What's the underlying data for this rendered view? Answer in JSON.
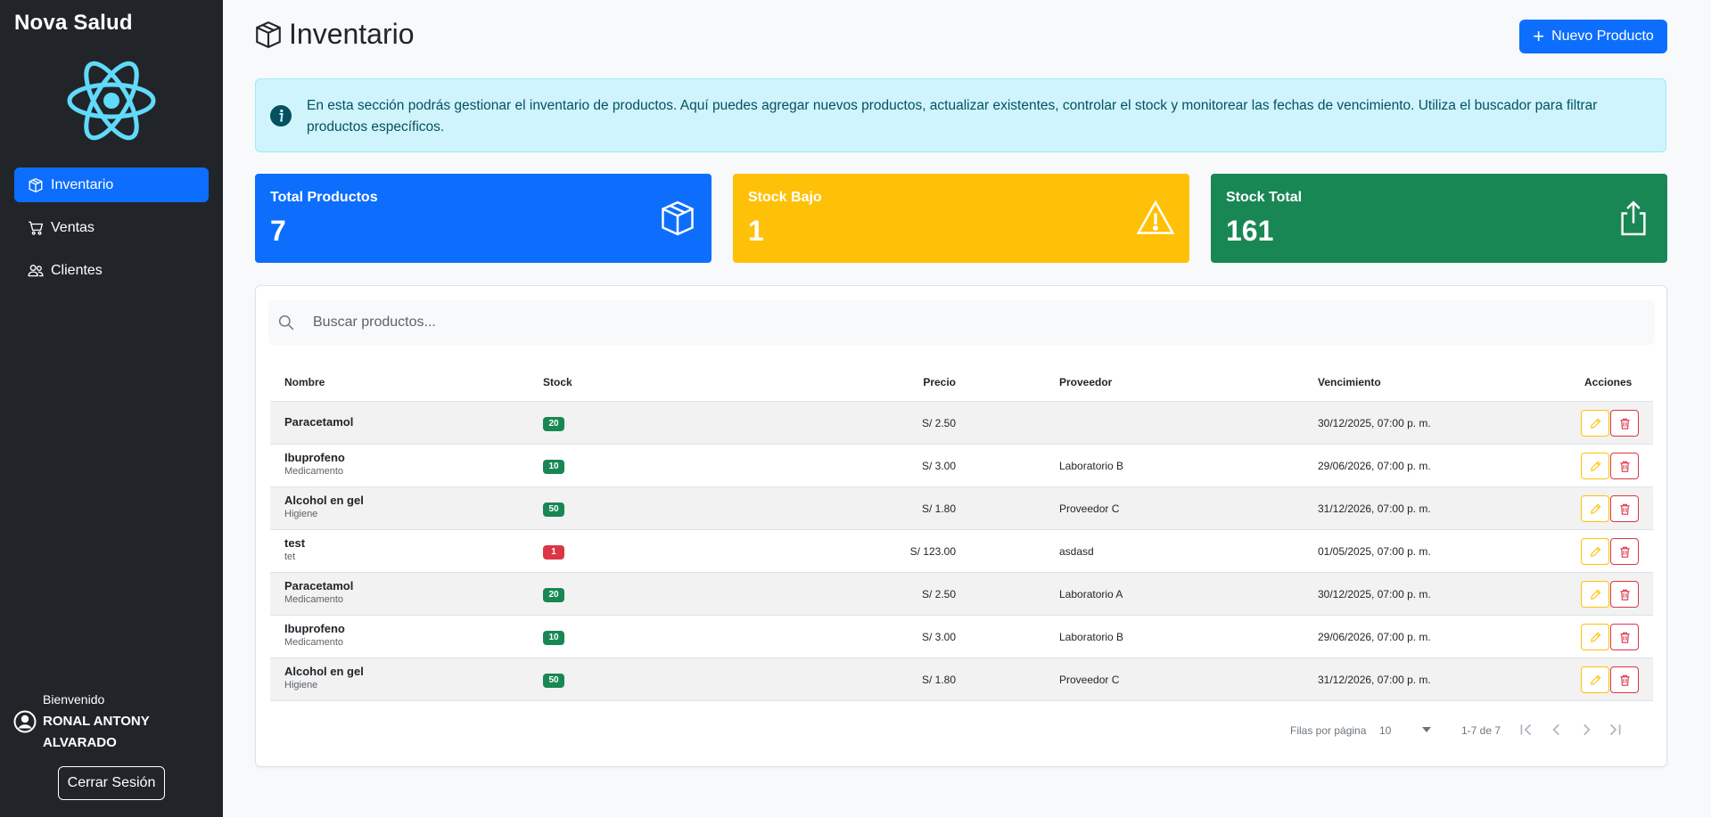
{
  "sidebar": {
    "brand": "Nova Salud",
    "logo_icon": "react-atom-icon",
    "items": [
      {
        "label": "Inventario",
        "icon": "box-icon",
        "active": true
      },
      {
        "label": "Ventas",
        "icon": "cart-icon",
        "active": false
      },
      {
        "label": "Clientes",
        "icon": "people-icon",
        "active": false
      }
    ],
    "welcome": "Bienvenido",
    "user_name": "RONAL ANTONY ALVARADO",
    "logout_label": "Cerrar Sesión"
  },
  "header": {
    "title": "Inventario",
    "new_button_label": "Nuevo Producto"
  },
  "alert": {
    "text": "En esta sección podrás gestionar el inventario de productos. Aquí puedes agregar nuevos productos, actualizar existentes, controlar el stock y monitorear las fechas de vencimiento. Utiliza el buscador para filtrar productos específicos."
  },
  "stats": [
    {
      "label": "Total Productos",
      "value": "7",
      "color": "#0d6efd",
      "icon": "box-icon"
    },
    {
      "label": "Stock Bajo",
      "value": "1",
      "color": "#ffc107",
      "icon": "warning-triangle-icon"
    },
    {
      "label": "Stock Total",
      "value": "161",
      "color": "#198754",
      "icon": "box-arrow-up-icon"
    }
  ],
  "search": {
    "placeholder": "Buscar productos..."
  },
  "table": {
    "columns": [
      "Nombre",
      "Stock",
      "Precio",
      "Proveedor",
      "Vencimiento",
      "Acciones"
    ],
    "rows": [
      {
        "name": "Paracetamol",
        "category": "",
        "stock": "20",
        "low": false,
        "price": "S/ 2.50",
        "provider": "",
        "expiry": "30/12/2025, 07:00 p. m."
      },
      {
        "name": "Ibuprofeno",
        "category": "Medicamento",
        "stock": "10",
        "low": false,
        "price": "S/ 3.00",
        "provider": "Laboratorio B",
        "expiry": "29/06/2026, 07:00 p. m."
      },
      {
        "name": "Alcohol en gel",
        "category": "Higiene",
        "stock": "50",
        "low": false,
        "price": "S/ 1.80",
        "provider": "Proveedor C",
        "expiry": "31/12/2026, 07:00 p. m."
      },
      {
        "name": "test",
        "category": "tet",
        "stock": "1",
        "low": true,
        "price": "S/ 123.00",
        "provider": "asdasd",
        "expiry": "01/05/2025, 07:00 p. m."
      },
      {
        "name": "Paracetamol",
        "category": "Medicamento",
        "stock": "20",
        "low": false,
        "price": "S/ 2.50",
        "provider": "Laboratorio A",
        "expiry": "30/12/2025, 07:00 p. m."
      },
      {
        "name": "Ibuprofeno",
        "category": "Medicamento",
        "stock": "10",
        "low": false,
        "price": "S/ 3.00",
        "provider": "Laboratorio B",
        "expiry": "29/06/2026, 07:00 p. m."
      },
      {
        "name": "Alcohol en gel",
        "category": "Higiene",
        "stock": "50",
        "low": false,
        "price": "S/ 1.80",
        "provider": "Proveedor C",
        "expiry": "31/12/2026, 07:00 p. m."
      }
    ]
  },
  "pagination": {
    "rows_per_page_label": "Filas por página",
    "rows_per_page": "10",
    "range": "1-7 de 7"
  }
}
